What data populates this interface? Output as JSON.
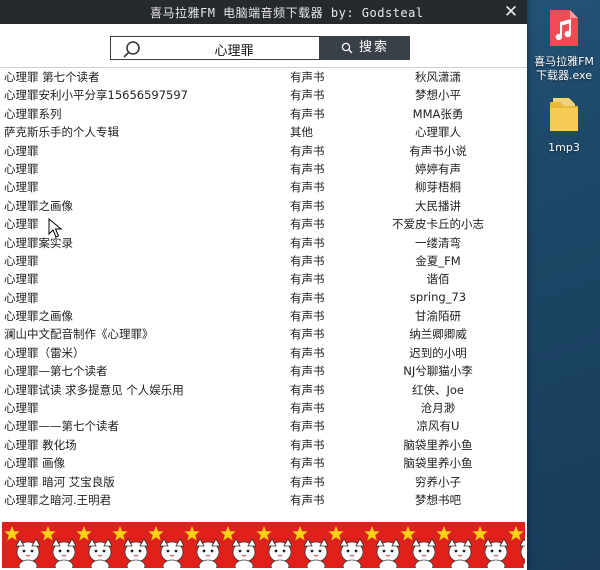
{
  "window": {
    "title": "喜马拉雅FM 电脑端音频下载器   by: Godsteal",
    "close_glyph": "✕"
  },
  "search": {
    "query": "心理罪",
    "button_label": "搜索"
  },
  "results": [
    {
      "title": "心理罪 第七个读者",
      "type": "有声书",
      "author": "秋风潇潇"
    },
    {
      "title": "心理罪安利小平分享15656597597",
      "type": "有声书",
      "author": "梦想小平"
    },
    {
      "title": "心理罪系列",
      "type": "有声书",
      "author": "MMA张勇"
    },
    {
      "title": "萨克斯乐手的个人专辑",
      "type": "其他",
      "author": "心理罪人"
    },
    {
      "title": "心理罪",
      "type": "有声书",
      "author": "有声书小说"
    },
    {
      "title": "心理罪",
      "type": "有声书",
      "author": "婷婷有声"
    },
    {
      "title": "心理罪",
      "type": "有声书",
      "author": "柳芽梧桐"
    },
    {
      "title": "心理罪之画像",
      "type": "有声书",
      "author": "大民播讲"
    },
    {
      "title": "心理罪",
      "type": "有声书",
      "author": "不爱皮卡丘的小志"
    },
    {
      "title": "心理罪案实录",
      "type": "有声书",
      "author": "一缕清弯"
    },
    {
      "title": "心理罪",
      "type": "有声书",
      "author": "金夏_FM"
    },
    {
      "title": "心理罪",
      "type": "有声书",
      "author": "谐佰"
    },
    {
      "title": "心理罪",
      "type": "有声书",
      "author": "spring_73"
    },
    {
      "title": "心理罪之画像",
      "type": "有声书",
      "author": "甘渝陌研"
    },
    {
      "title": "澜山中文配音制作《心理罪》",
      "type": "有声书",
      "author": "纳兰卿卿威"
    },
    {
      "title": "心理罪（雷米）",
      "type": "有声书",
      "author": "迟到的小明"
    },
    {
      "title": "心理罪—第七个读者",
      "type": "有声书",
      "author": "NJ兮聊猫小李"
    },
    {
      "title": "心理罪试读 求多提意见 个人娱乐用",
      "type": "有声书",
      "author": "红侠、Joe"
    },
    {
      "title": "心理罪",
      "type": "有声书",
      "author": "沧月渺"
    },
    {
      "title": "心理罪——第七个读者",
      "type": "有声书",
      "author": "凉风有U"
    },
    {
      "title": "心理罪 教化场",
      "type": "有声书",
      "author": "脑袋里养小鱼"
    },
    {
      "title": "心理罪 画像",
      "type": "有声书",
      "author": "脑袋里养小鱼"
    },
    {
      "title": "心理罪 暗河 艾宝良版",
      "type": "有声书",
      "author": "穷养小子"
    },
    {
      "title": "心理罪之暗河.王明君",
      "type": "有声书",
      "author": "梦想书吧"
    }
  ],
  "desktop": {
    "icons": [
      {
        "label": "喜马拉雅FM下载器.exe",
        "icon": "music-file-icon"
      },
      {
        "label": "1mp3",
        "icon": "folder-icon"
      }
    ]
  },
  "colors": {
    "titlebar": "#262a2f",
    "button": "#3a4048",
    "banner": "#e0211b"
  }
}
